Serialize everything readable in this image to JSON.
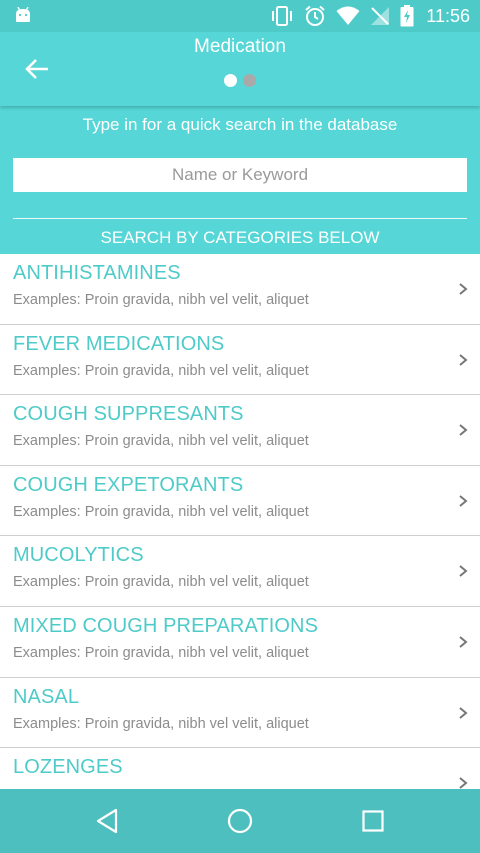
{
  "status_bar": {
    "time": "11:56",
    "icons": [
      "android-icon",
      "vibrate-icon",
      "alarm-icon",
      "wifi-icon",
      "no-signal-icon",
      "battery-charging-icon"
    ]
  },
  "app_bar": {
    "title": "Medication",
    "back_icon": "arrow-left-icon",
    "page_indicator": {
      "total": 2,
      "active": 1
    }
  },
  "search": {
    "hint": "Type in for a quick search in the database",
    "placeholder": "Name or Keyword",
    "categories_header": "SEARCH BY CATEGORIES BELOW"
  },
  "categories": [
    {
      "title": "ANTIHISTAMINES",
      "examples": "Examples: Proin gravida, nibh vel velit, aliquet"
    },
    {
      "title": "FEVER MEDICATIONS",
      "examples": "Examples: Proin gravida, nibh vel velit, aliquet"
    },
    {
      "title": "COUGH SUPPRESANTS",
      "examples": "Examples: Proin gravida, nibh vel velit, aliquet"
    },
    {
      "title": "COUGH EXPETORANTS",
      "examples": "Examples: Proin gravida, nibh vel velit, aliquet"
    },
    {
      "title": "MUCOLYTICS",
      "examples": "Examples: Proin gravida, nibh vel velit, aliquet"
    },
    {
      "title": "MIXED COUGH PREPARATIONS",
      "examples": "Examples: Proin gravida, nibh vel velit, aliquet"
    },
    {
      "title": "NASAL",
      "examples": "Examples: Proin gravida, nibh vel velit, aliquet"
    },
    {
      "title": "LOZENGES",
      "examples": ""
    }
  ],
  "nav_bar": {
    "icons": [
      "back-triangle-icon",
      "home-circle-icon",
      "recents-square-icon"
    ]
  },
  "colors": {
    "status_bar": "#4ecbc9",
    "app_bar": "#56d6d6",
    "accent_text": "#4ecbc9",
    "nav_bar": "#4ebfbf"
  }
}
